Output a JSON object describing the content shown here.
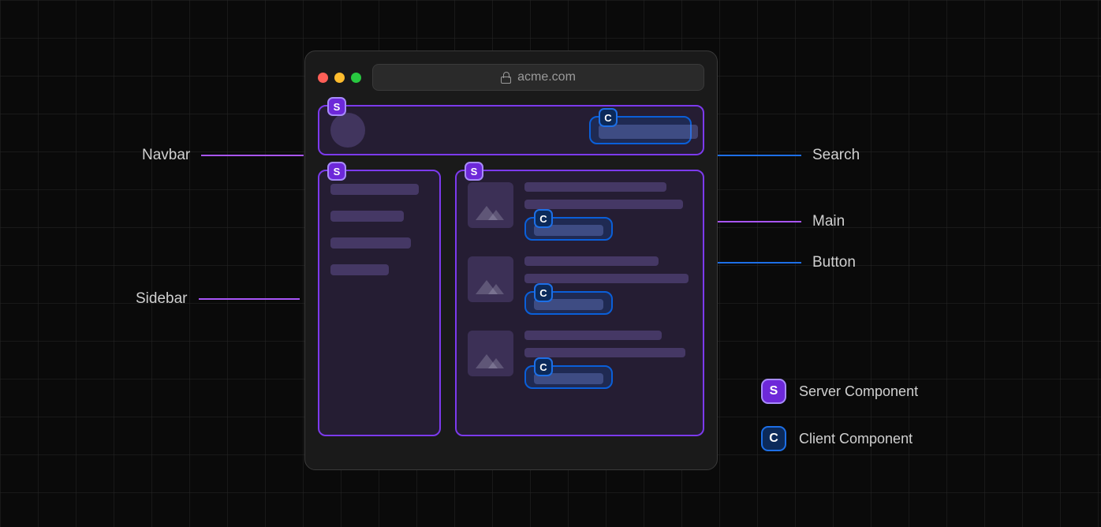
{
  "browser": {
    "url": "acme.com"
  },
  "badges": {
    "server_letter": "S",
    "client_letter": "C"
  },
  "annotations": {
    "navbar": "Navbar",
    "sidebar": "Sidebar",
    "search": "Search",
    "main": "Main",
    "button": "Button"
  },
  "legend": {
    "server": "Server Component",
    "client": "Client Component"
  },
  "regions": {
    "navbar": {
      "component_type": "server",
      "children": {
        "search": {
          "component_type": "client"
        }
      }
    },
    "sidebar": {
      "component_type": "server",
      "item_count": 4
    },
    "main": {
      "component_type": "server",
      "items": [
        {
          "button": {
            "component_type": "client"
          }
        },
        {
          "button": {
            "component_type": "client"
          }
        },
        {
          "button": {
            "component_type": "client"
          }
        }
      ]
    }
  },
  "colors": {
    "server_border": "#7c3aed",
    "client_border": "#1d6fe6"
  }
}
